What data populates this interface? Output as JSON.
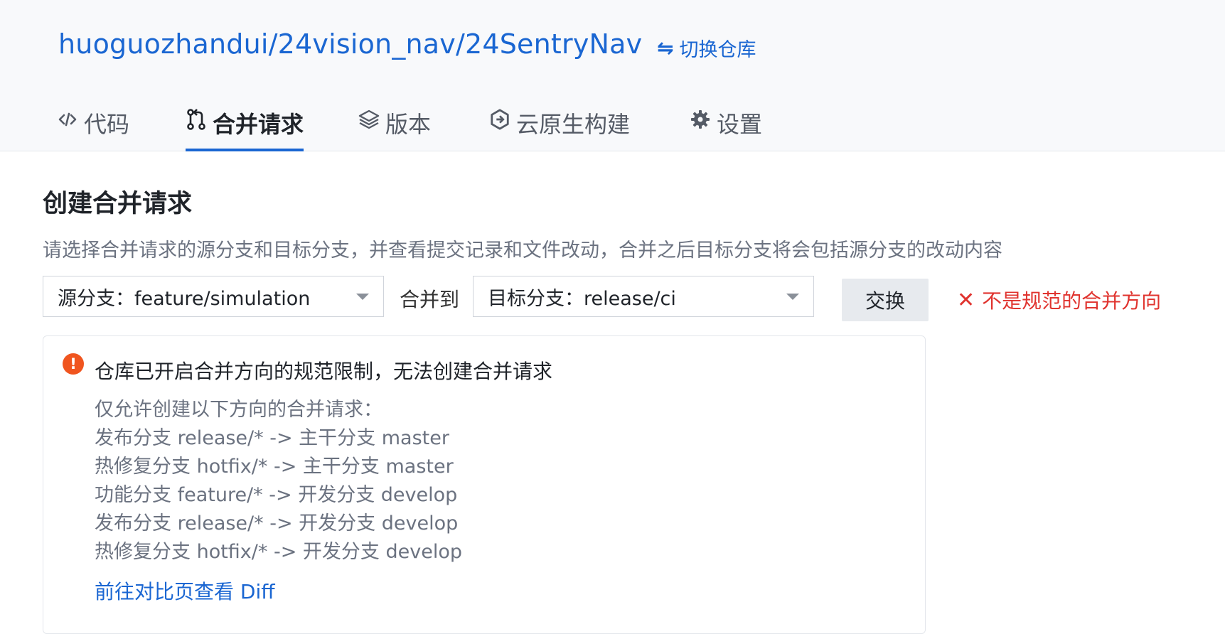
{
  "header": {
    "repo_path": "huoguozhandui/24vision_nav/24SentryNav",
    "switch_repo": {
      "icon": "swap-arrows-icon",
      "label": "切换仓库"
    }
  },
  "tabs": [
    {
      "label": "代码",
      "icon": "code-icon",
      "active": false
    },
    {
      "label": "合并请求",
      "icon": "pull-request-icon",
      "active": true
    },
    {
      "label": "版本",
      "icon": "layers-icon",
      "active": false
    },
    {
      "label": "云原生构建",
      "icon": "cloud-build-icon",
      "active": false
    },
    {
      "label": "设置",
      "icon": "gear-icon",
      "active": false
    }
  ],
  "page": {
    "title": "创建合并请求",
    "description": "请选择合并请求的源分支和目标分支，并查看提交记录和文件改动，合并之后目标分支将会包括源分支的改动内容"
  },
  "branch_select": {
    "source": "源分支：feature/simulation",
    "merge_to": "合并到",
    "target": "目标分支：release/ci",
    "swap_label": "交换",
    "invalid_text": "不是规范的合并方向"
  },
  "alert": {
    "title": "仓库已开启合并方向的规范限制，无法创建合并请求",
    "rules": [
      "仅允许创建以下方向的合并请求：",
      "发布分支 release/* -> 主干分支 master",
      "热修复分支 hotfix/* -> 主干分支 master",
      "功能分支 feature/* -> 开发分支 develop",
      "发布分支 release/* -> 开发分支 develop",
      "热修复分支 hotfix/* -> 开发分支 develop"
    ],
    "diff_link": "前往对比页查看 Diff"
  },
  "colors": {
    "accent": "#1a66d2",
    "error": "#e0342f",
    "warning": "#f0551f"
  }
}
